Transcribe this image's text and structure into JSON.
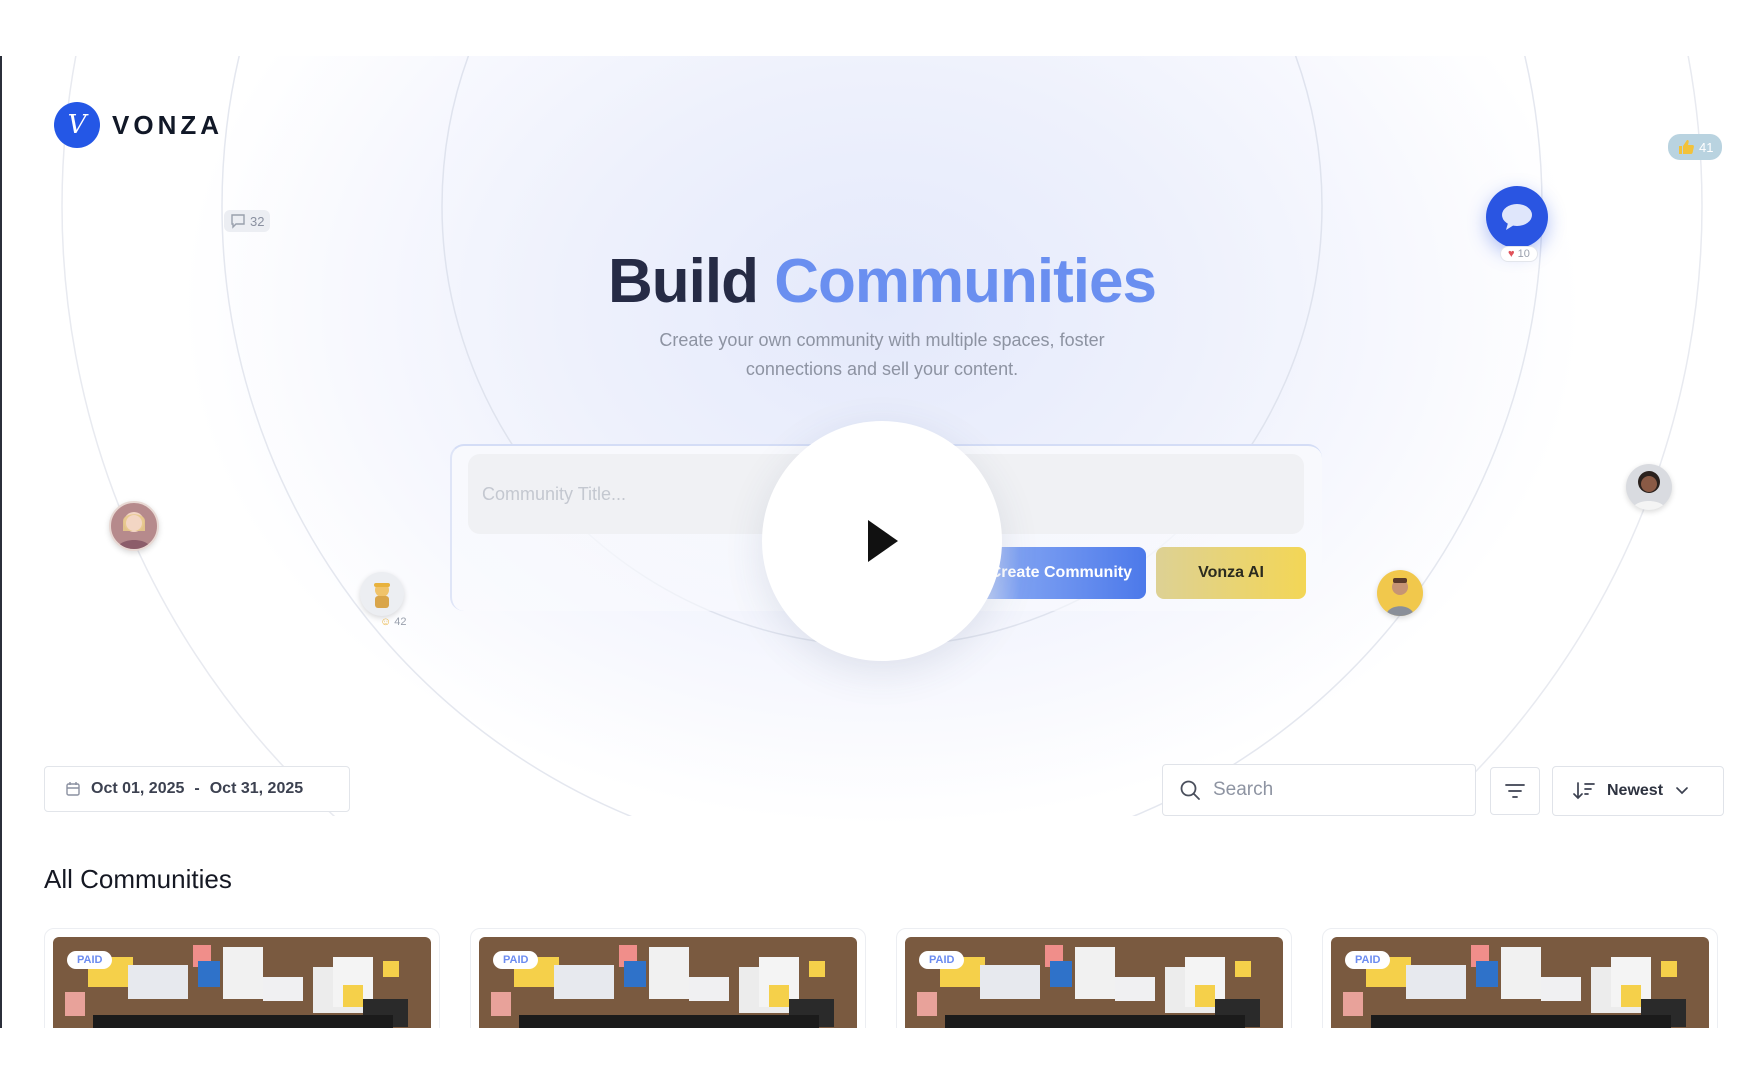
{
  "brand": {
    "name": "VONZA",
    "logo_glyph": "V"
  },
  "floating": {
    "comments_count": "32",
    "likes_count": "41",
    "heart_count": "10",
    "emoji_count": "42"
  },
  "hero": {
    "title_plain": "Build",
    "title_accent": "Communities",
    "subtitle": "Create your own community with multiple spaces, foster connections and sell your content."
  },
  "composer": {
    "title_placeholder": "Community Title...",
    "create_label": "Create Community",
    "ai_label": "Vonza AI"
  },
  "toolbar": {
    "date_start": "Oct 01, 2025",
    "date_separator": "-",
    "date_end": "Oct 31, 2025",
    "search_placeholder": "Search",
    "sort_label": "Newest"
  },
  "section": {
    "title": "All Communities"
  },
  "cards": [
    {
      "badge": "PAID"
    },
    {
      "badge": "PAID"
    },
    {
      "badge": "PAID"
    },
    {
      "badge": "PAID"
    }
  ],
  "colors": {
    "brand_blue": "#2457e6",
    "accent_title": "#6a8ff0",
    "ai_yellow": "#f3d656"
  },
  "icons": [
    "comment-icon",
    "thumbs-up-icon",
    "chat-bubble-icon",
    "heart-icon",
    "play-icon",
    "calendar-icon",
    "search-icon",
    "filter-icon",
    "sort-icon",
    "chevron-down-icon"
  ]
}
